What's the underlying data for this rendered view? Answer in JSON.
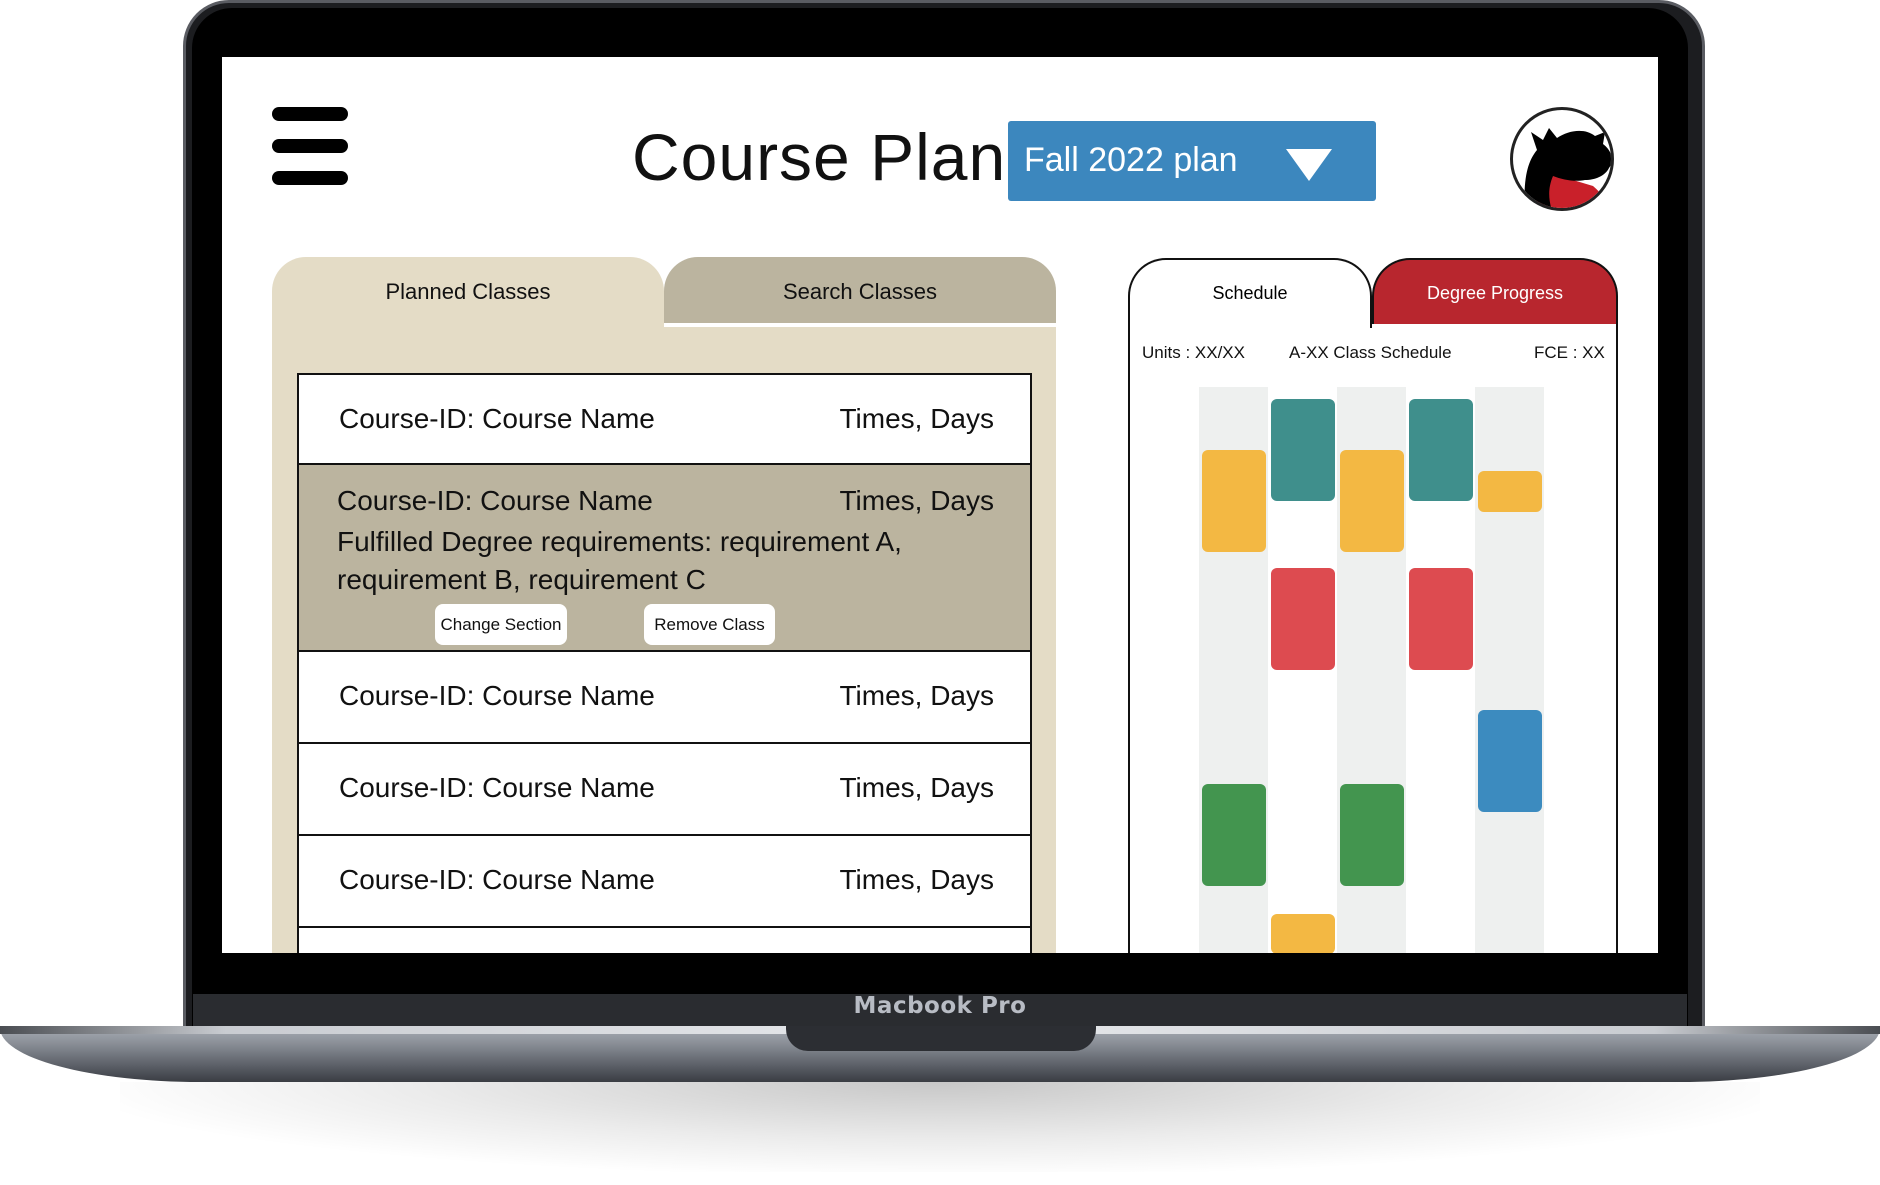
{
  "device": {
    "brand_label": "Macbook Pro"
  },
  "header": {
    "title": "Course Plan:",
    "plan_select": {
      "value": "Fall 2022 plan"
    },
    "menu_icon": "hamburger-menu-icon",
    "avatar_icon": "scottie-dog-avatar"
  },
  "left_panel": {
    "tabs": [
      {
        "label": "Planned Classes",
        "active": true
      },
      {
        "label": "Search Classes",
        "active": false
      }
    ],
    "classes": [
      {
        "name": "Course-ID: Course Name",
        "time": "Times, Days"
      },
      {
        "name": "Course-ID: Course Name",
        "time": "Times, Days",
        "requirements": "Fulfilled Degree requirements: requirement A, requirement B, requirement C",
        "change_section_label": "Change Section",
        "remove_class_label": "Remove Class"
      },
      {
        "name": "Course-ID: Course Name",
        "time": "Times, Days"
      },
      {
        "name": "Course-ID: Course Name",
        "time": "Times, Days"
      },
      {
        "name": "Course-ID: Course Name",
        "time": "Times, Days"
      }
    ]
  },
  "right_panel": {
    "tabs": [
      {
        "label": "Schedule",
        "active": true
      },
      {
        "label": "Degree Progress",
        "active": false
      }
    ],
    "units": "Units : XX/XX",
    "schedule_title": "A-XX Class Schedule",
    "fce": "FCE : XX",
    "colors": {
      "yellow": "#f3b843",
      "teal": "#3f8f8c",
      "red": "#dd4b50",
      "green": "#43954f",
      "blue": "#3c8bbf"
    }
  }
}
